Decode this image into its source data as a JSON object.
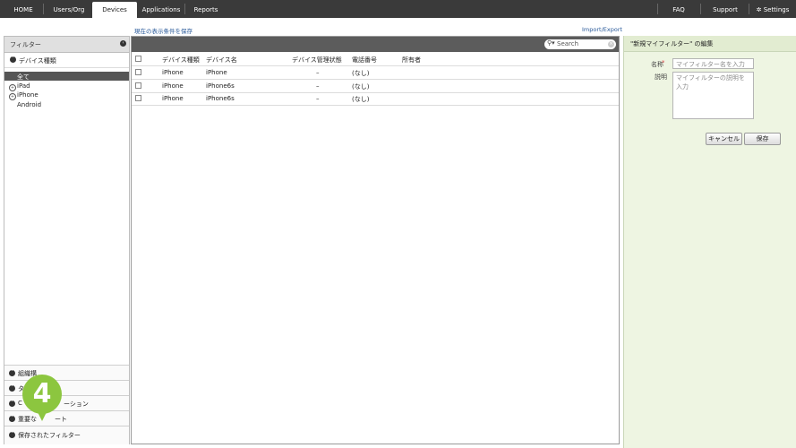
{
  "nav": {
    "tabs": [
      "HOME",
      "Users/Org",
      "Devices",
      "Applications",
      "Reports"
    ],
    "active": "Devices",
    "right": [
      "FAQ",
      "Support",
      "Settings"
    ]
  },
  "links": {
    "save_view": "現在の表示条件を保存",
    "import_export": "Import/Export"
  },
  "left": {
    "title": "フィルター",
    "device_type_header": "デバイス種類",
    "items": [
      "全て",
      "iPad",
      "iPhone",
      "Android"
    ],
    "sections": [
      "組織構造",
      "タグ",
      "Custom Application",
      "重要なアラート",
      "保存されたフィルター"
    ],
    "sections_visible": [
      "組織構",
      "タ",
      "C",
      "ーション",
      "重要な",
      "ート",
      "保存されたフィルター"
    ]
  },
  "search": {
    "placeholder": "Search"
  },
  "table": {
    "headers": [
      "デバイス種類",
      "デバイス名",
      "デバイス管理状態",
      "電話番号",
      "所有者"
    ],
    "rows": [
      {
        "type": "iPhone",
        "name": "iPhone",
        "state": "–",
        "phone": "(なし)",
        "owner": ""
      },
      {
        "type": "iPhone",
        "name": "iPhone6s",
        "state": "–",
        "phone": "(なし)",
        "owner": ""
      },
      {
        "type": "iPhone",
        "name": "iPhone6s",
        "state": "–",
        "phone": "(なし)",
        "owner": ""
      }
    ]
  },
  "editor": {
    "title": "\"新規マイフィルター\" の編集",
    "name_label": "名称",
    "name_placeholder": "マイフィルター名を入力",
    "desc_label": "説明",
    "desc_placeholder": "マイフィルターの説明を入力",
    "cancel": "キャンセル",
    "save": "保存"
  },
  "callout": {
    "number": "4"
  },
  "colors": {
    "nav_bg": "#3a3a3a",
    "grid_bar": "#5c5c5c",
    "editor_bg": "#eef5e2",
    "callout": "#8cc63f",
    "required": "#e05050"
  }
}
